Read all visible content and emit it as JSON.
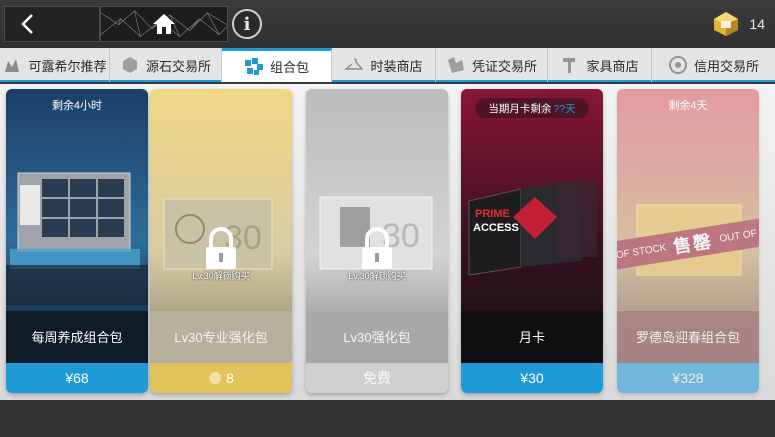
{
  "header": {
    "currency_value": "14",
    "icons": [
      "back-arrow-icon",
      "home-icon",
      "info-icon",
      "originium-crystal-icon"
    ]
  },
  "tabs": [
    {
      "label": "可露希尔推荐",
      "icon": "recommend-icon",
      "active": false
    },
    {
      "label": "源石交易所",
      "icon": "originium-icon",
      "active": false
    },
    {
      "label": "组合包",
      "icon": "bundle-cubes-icon",
      "active": true
    },
    {
      "label": "时装商店",
      "icon": "hanger-icon",
      "active": false
    },
    {
      "label": "凭证交易所",
      "icon": "voucher-icon",
      "active": false
    },
    {
      "label": "家具商店",
      "icon": "hammer-icon",
      "active": false
    },
    {
      "label": "信用交易所",
      "icon": "credit-icon",
      "active": false
    }
  ],
  "cards": [
    {
      "name": "每周养成组合包",
      "badge": "剩余4小时",
      "price": "¥68",
      "price_color": "#1e9bd7",
      "state": "available"
    },
    {
      "name": "Lv30专业强化包",
      "lock_text": "Lv.30解锁购买",
      "price": "8",
      "price_color": "#e0c35a",
      "state": "locked"
    },
    {
      "name": "Lv30强化包",
      "lock_text": "Lv.30解锁购买",
      "price": "免费",
      "price_color": "#cfcfcf",
      "state": "locked"
    },
    {
      "name": "月卡",
      "badge_prefix": "当期月卡剩余",
      "badge_highlight": "??天",
      "price": "¥30",
      "price_color": "#1e9bd7",
      "state": "available"
    },
    {
      "name": "罗德岛迎春组合包",
      "badge": "剩余4天",
      "soldout_left": "OF STOCK",
      "soldout_center": "售罄",
      "soldout_right": "OUT OF ST",
      "price": "¥328",
      "price_color": "#1e9bd7",
      "state": "sold-out"
    }
  ]
}
